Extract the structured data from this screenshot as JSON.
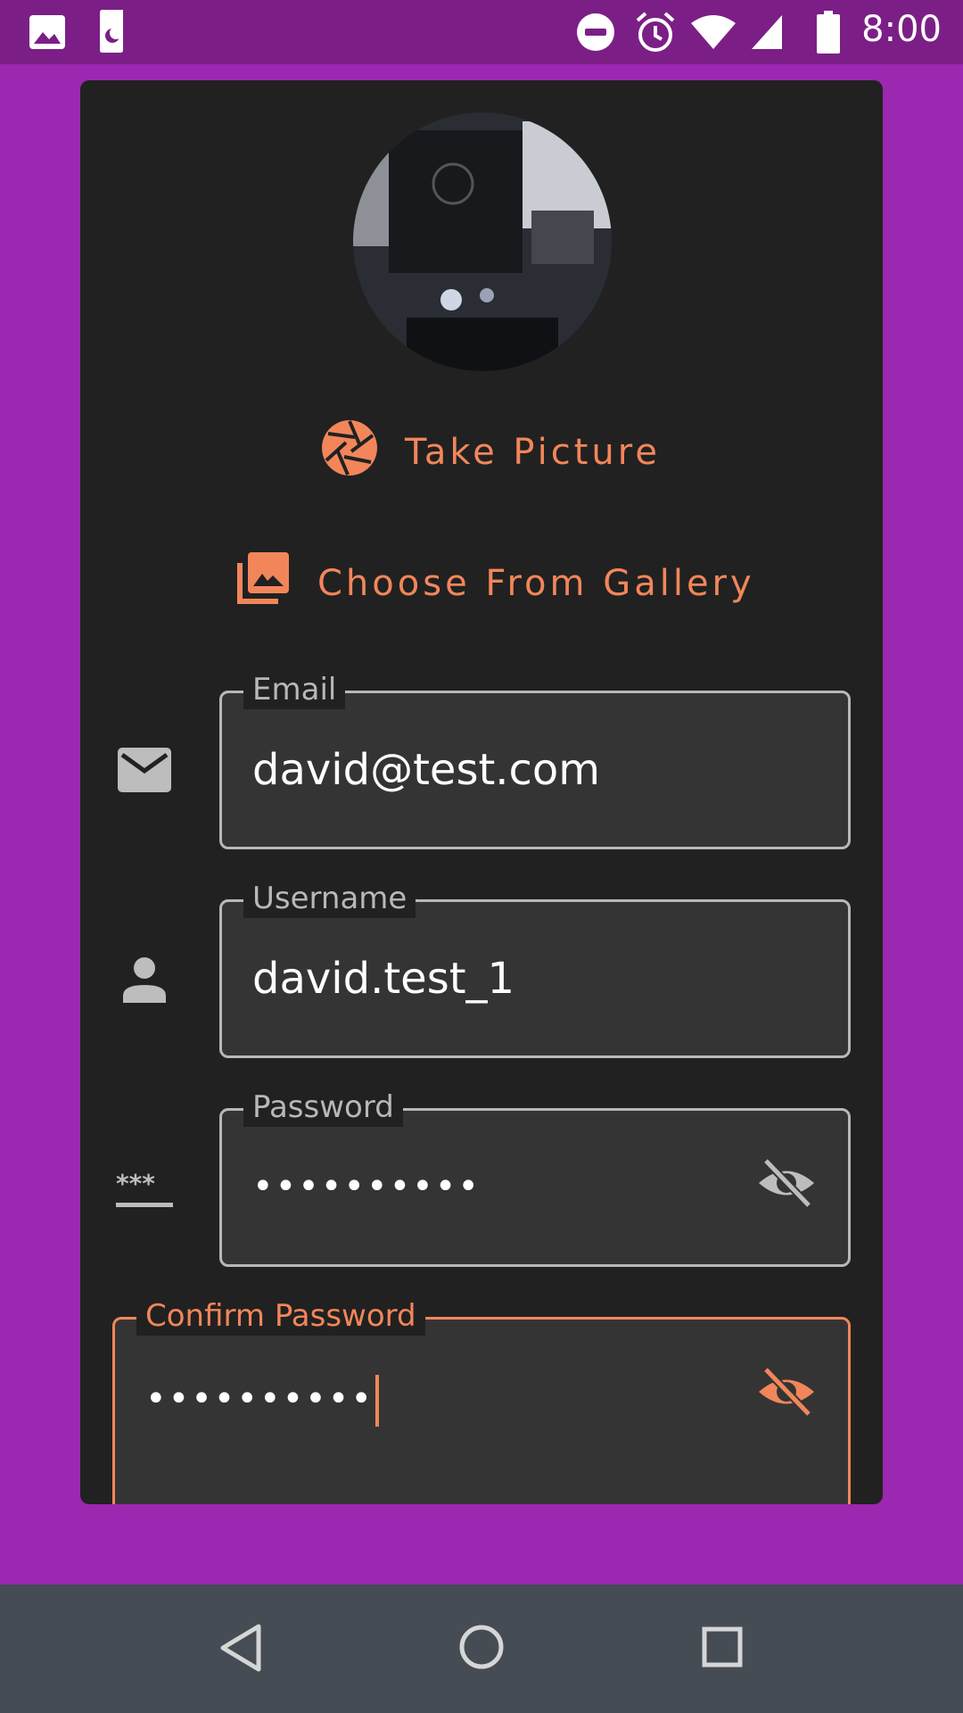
{
  "status_bar": {
    "time": "8:00",
    "icons_left": [
      "image-icon",
      "sim-card-icon"
    ],
    "icons_right": [
      "do-not-disturb-icon",
      "alarm-icon",
      "wifi-icon",
      "signal-icon",
      "battery-icon"
    ]
  },
  "profile": {
    "take_picture_label": "Take Picture",
    "choose_gallery_label": "Choose From Gallery"
  },
  "form": {
    "email": {
      "label": "Email",
      "value": "david@test.com"
    },
    "username": {
      "label": "Username",
      "value": "david.test_1"
    },
    "password": {
      "label": "Password",
      "value": "••••••••••"
    },
    "confirm_password": {
      "label": "Confirm Password",
      "value": "••••••••••"
    }
  },
  "colors": {
    "background": "#9c27b0",
    "status_bar": "#7b1f86",
    "card": "#212121",
    "field": "#343434",
    "accent": "#f2865a",
    "nav_bar": "#454c54"
  },
  "nav": {
    "buttons": [
      "back-icon",
      "home-icon",
      "recents-icon"
    ]
  }
}
